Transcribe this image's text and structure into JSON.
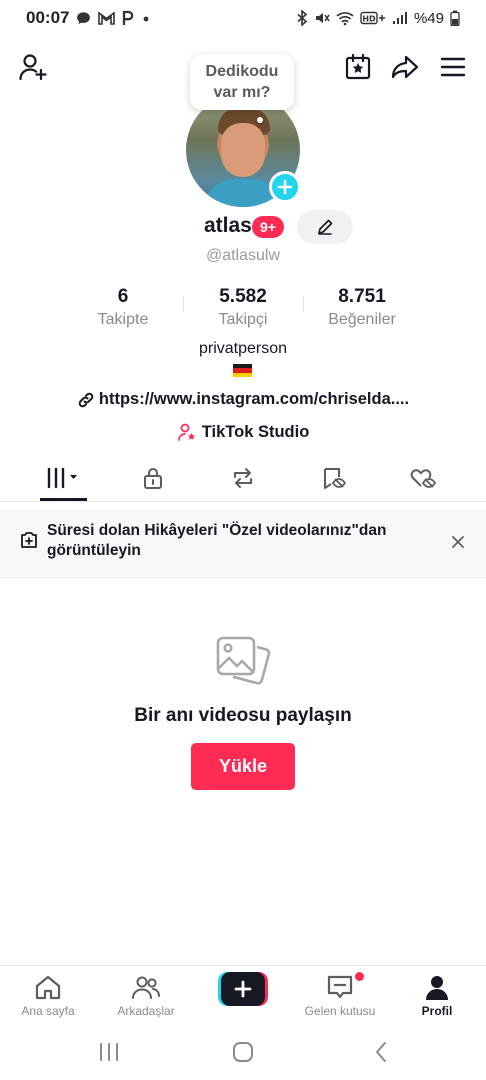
{
  "status_bar": {
    "time": "00:07",
    "left_icons": [
      "chat-bubble-icon",
      "gmail-icon",
      "p-icon",
      "dot-icon"
    ],
    "right_icons": [
      "bluetooth-icon",
      "mute-icon",
      "wifi-icon",
      "hd-plus-icon",
      "signal-icon",
      "battery-icon"
    ],
    "battery": "%49"
  },
  "header": {
    "icons": [
      "add-friend-icon",
      "calendar-star-icon",
      "share-icon",
      "menu-icon"
    ]
  },
  "profile": {
    "bubble_text_line1": "Dedikodu",
    "bubble_text_line2": "var mı?",
    "username": "atlas",
    "notification_badge": "9+",
    "handle": "@atlasulw"
  },
  "stats": [
    {
      "value": "6",
      "label": "Takipte"
    },
    {
      "value": "5.582",
      "label": "Takipçi"
    },
    {
      "value": "8.751",
      "label": "Beğeniler"
    }
  ],
  "bio": {
    "text": "privatperson",
    "flag": "germany-flag",
    "link": "https://www.instagram.com/chriselda....",
    "studio": "TikTok Studio"
  },
  "tabs": [
    {
      "icon": "videos-grid-icon",
      "active": true
    },
    {
      "icon": "lock-icon",
      "active": false
    },
    {
      "icon": "repost-icon",
      "active": false
    },
    {
      "icon": "favorites-icon",
      "active": false
    },
    {
      "icon": "liked-hidden-icon",
      "active": false
    }
  ],
  "notice": {
    "text": "Süresi dolan Hikâyeleri \"Özel videolarınız\"dan görüntüleyin"
  },
  "empty_state": {
    "title": "Bir anı videosu paylaşın",
    "button": "Yükle"
  },
  "bottom_nav": [
    {
      "label": "Ana sayfa",
      "icon": "home-icon",
      "active": false
    },
    {
      "label": "Arkadaşlar",
      "icon": "friends-icon",
      "active": false
    },
    {
      "label": "",
      "icon": "create-plus-icon",
      "active": false
    },
    {
      "label": "Gelen kutusu",
      "icon": "inbox-icon",
      "active": false
    },
    {
      "label": "Profil",
      "icon": "profile-icon",
      "active": true
    }
  ],
  "colors": {
    "accent": "#fe2c55",
    "cyan": "#20d5ec",
    "text": "#161823",
    "muted": "#8a8b91"
  }
}
